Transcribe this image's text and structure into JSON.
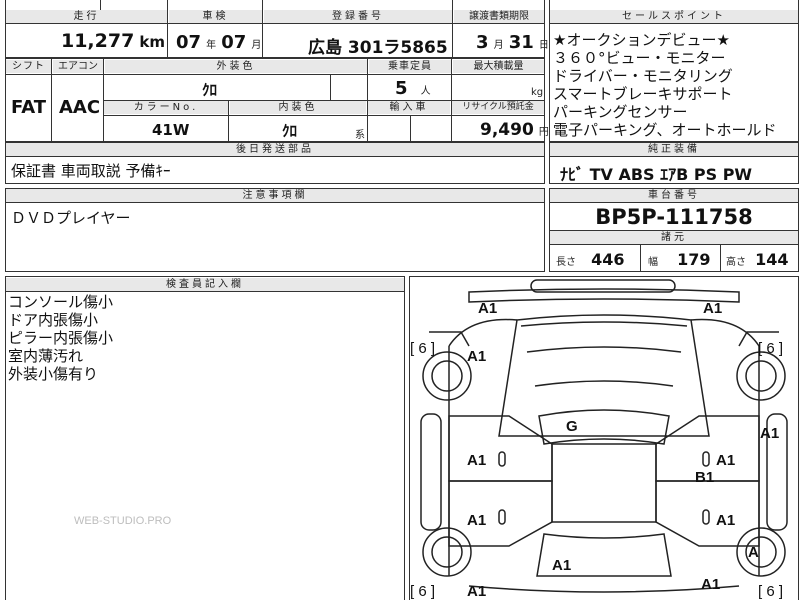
{
  "header": {
    "mileage_label": "走行",
    "mileage_value": "11,277",
    "mileage_unit": "km",
    "inspection_label": "車検",
    "inspection_year": "07",
    "inspection_year_unit": "年",
    "inspection_month": "07",
    "inspection_month_unit": "月",
    "registration_label": "登録番号",
    "registration_value": "広島 301ラ5865",
    "transfer_label": "譲渡書類期限",
    "transfer_month": "3",
    "transfer_month_unit": "月",
    "transfer_day": "31",
    "transfer_day_unit": "日"
  },
  "specs": {
    "shift_label": "シフト",
    "shift_value": "FAT",
    "aircon_label": "エアコン",
    "aircon_value": "AAC",
    "exterior_color_label": "外装色",
    "exterior_color_value": "ｸﾛ",
    "capacity_label": "乗車定員",
    "capacity_value": "5",
    "capacity_unit": "人",
    "max_load_label": "最大積載量",
    "max_load_unit": "kg",
    "color_no_label": "カラーNo.",
    "color_no_value": "41W",
    "interior_color_label": "内装色",
    "interior_color_value": "ｸﾛ",
    "interior_color_unit": "系",
    "import_label": "輸入車",
    "recycle_label": "リサイクル預託金",
    "recycle_value": "9,490",
    "recycle_unit": "円"
  },
  "sales_points": {
    "title": "セールスポイント",
    "lines": [
      "★オークションデビュー★",
      "３６０°ビュー・モニター",
      "ドライバー・モニタリング",
      "スマートブレーキサポート",
      "パーキングセンサー",
      "電子パーキング、オートホールド"
    ]
  },
  "later_parts": {
    "title": "後日発送部品",
    "value": "保証書 車両取説 予備ｷｰ"
  },
  "genuine_equipment": {
    "title": "純正装備",
    "value": "ﾅﾋﾞ TV ABS ｴｱB PS PW"
  },
  "notes": {
    "title": "注意事項欄",
    "value": "ＤＶＤプレイヤー"
  },
  "chassis": {
    "title": "車台番号",
    "value": "BP5P-111758"
  },
  "dimensions": {
    "title": "諸元",
    "length_label": "長さ",
    "length_value": "446",
    "width_label": "幅",
    "width_value": "179",
    "height_label": "高さ",
    "height_value": "144"
  },
  "inspector": {
    "title": "検査員記入欄",
    "lines": [
      "コンソール傷小",
      "ドア内張傷小",
      "ピラー内張傷小",
      "室内薄汚れ",
      "外装小傷有り"
    ]
  },
  "diagram": {
    "marks": [
      "A1",
      "A1",
      "A1",
      "G",
      "A1",
      "A1",
      "A1",
      "B1",
      "A1",
      "A1",
      "A1",
      "A",
      "A1",
      "A1"
    ],
    "brackets": [
      "[ 6 ]",
      "[ 6 ]",
      "[ 6 ]",
      "[ 6 ]"
    ]
  },
  "watermark": "WEB-STUDIO.PRO"
}
